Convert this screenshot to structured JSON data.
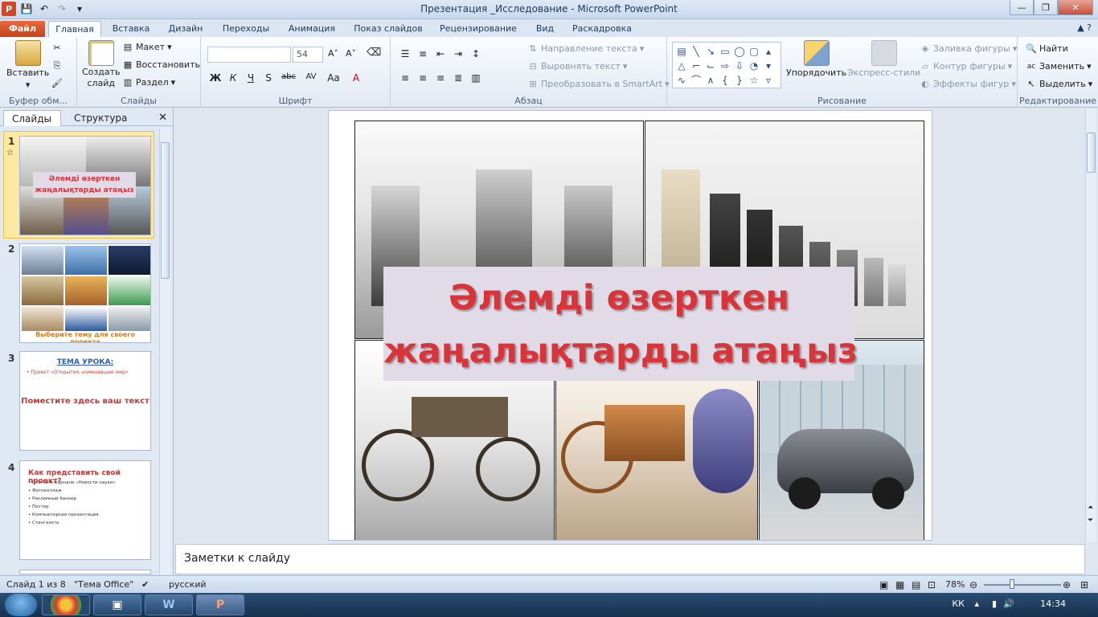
{
  "window": {
    "title": "Презентация _Исследование - Microsoft PowerPoint",
    "app_letter": "P"
  },
  "ribbon_tabs": [
    "Файл",
    "Главная",
    "Вставка",
    "Дизайн",
    "Переходы",
    "Анимация",
    "Показ слайдов",
    "Рецензирование",
    "Вид",
    "Раскадровка"
  ],
  "ribbon": {
    "clipboard": {
      "paste": "Вставить",
      "label": "Буфер обм..."
    },
    "slides": {
      "new_slide_line1": "Создать",
      "new_slide_line2": "слайд",
      "layout": "Макет",
      "reset": "Восстановить",
      "section": "Раздел",
      "label": "Слайды"
    },
    "font": {
      "font_name": "",
      "font_size": "54",
      "bold": "Ж",
      "italic": "К",
      "underline": "Ч",
      "shadow": "S",
      "strike": "abc",
      "spacing": "AV",
      "case": "Aa",
      "color": "A",
      "label": "Шрифт"
    },
    "paragraph": {
      "text_direction": "Направление текста",
      "align_text": "Выровнять текст",
      "smartart": "Преобразовать в SmartArt",
      "label": "Абзац"
    },
    "drawing": {
      "arrange": "Упорядочить",
      "quick_styles": "Экспресс-стили",
      "fill": "Заливка фигуры",
      "outline": "Контур фигуры",
      "effects": "Эффекты фигур",
      "label": "Рисование"
    },
    "editing": {
      "find": "Найти",
      "replace": "Заменить",
      "select": "Выделить",
      "label": "Редактирование"
    }
  },
  "panel": {
    "tab_slides": "Слайды",
    "tab_outline": "Структура",
    "thumbnails": [
      {
        "num": "1",
        "title_line1": "Әлемді өзерткен",
        "title_line2": "жаңалықтарды атаңыз"
      },
      {
        "num": "2",
        "caption": "Выберите тему для своего проекта"
      },
      {
        "num": "3",
        "heading": "ТЕМА УРОКА:",
        "bullet": "Проект «Открытия, изменившие мир»",
        "body": "Поместите здесь ваш текст"
      },
      {
        "num": "4",
        "heading": "Как представить свой проект?",
        "bullets": [
          "Статья в журнале «Новости науки»",
          "Фотоколлаж",
          "Рекламный баннер",
          "Постер",
          "Компьютерная презентация",
          "Стенгазета"
        ]
      }
    ]
  },
  "slide": {
    "title_line1": "Әлемді өзерткен",
    "title_line2": "жаңалықтарды атаңыз"
  },
  "notes_placeholder": "Заметки к слайду",
  "status": {
    "slide_of": "Слайд 1 из 8",
    "theme": "\"Тема Office\"",
    "language": "русский",
    "zoom": "78%"
  },
  "taskbar": {
    "lang": "КК",
    "time": "14:34"
  },
  "colors": {
    "accent": "#d24726",
    "title_red": "#d8343a",
    "selection": "#fde9a3"
  }
}
